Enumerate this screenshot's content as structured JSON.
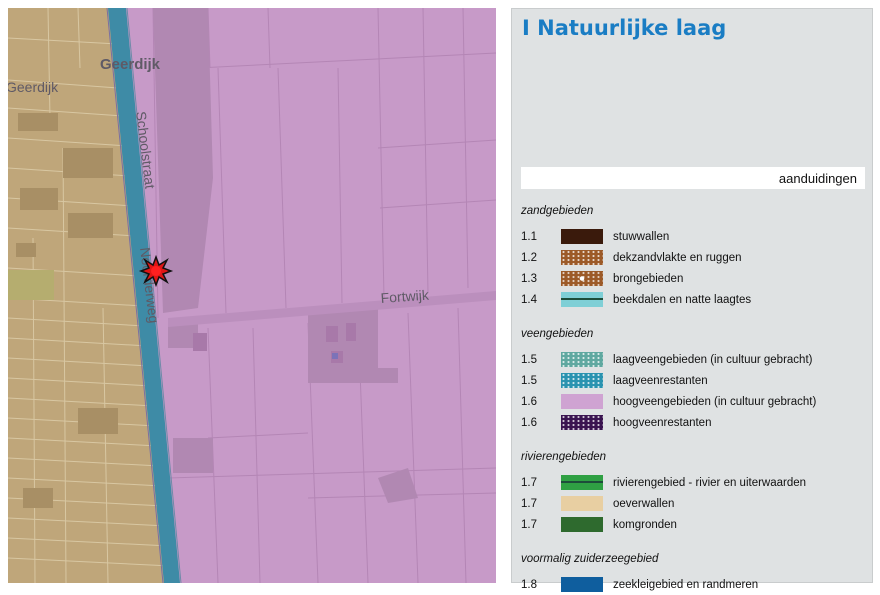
{
  "map": {
    "street_labels": {
      "geerdijk_top": "Geerdijk",
      "geerdijk_left": "Geerdijk",
      "schoolstraat": "Schoolstraat",
      "noorderweg": "Noorderweg",
      "fortwijk": "Fortwijk"
    },
    "colors": {
      "sand": "#bfa67a",
      "peat": "#c79ac8",
      "water": "#3e8ba6",
      "marker": "#e01515"
    },
    "marker_icon": "location-star-icon"
  },
  "legend": {
    "title": "I Natuurlijke laag",
    "aanduidingen_label": "aanduidingen",
    "sections": [
      {
        "heading": "zandgebieden",
        "items": [
          {
            "code": "1.1",
            "label": "stuwwallen",
            "color": "#3a1a0c",
            "pattern": "solid"
          },
          {
            "code": "1.2",
            "label": "dekzandvlakte en ruggen",
            "color": "#9c5a28",
            "pattern": "dots"
          },
          {
            "code": "1.3",
            "label": "brongebieden",
            "color": "#9c5a28",
            "pattern": "dots-center"
          },
          {
            "code": "1.4",
            "label": "beekdalen en natte laagtes",
            "color": "#7fcfd6",
            "pattern": "line"
          }
        ]
      },
      {
        "heading": "veengebieden",
        "items": [
          {
            "code": "1.5",
            "label": "laagveengebieden (in cultuur gebracht)",
            "color": "#5fa8a0",
            "pattern": "dots"
          },
          {
            "code": "1.5",
            "label": "laagveenrestanten",
            "color": "#2a93b0",
            "pattern": "dots"
          },
          {
            "code": "1.6",
            "label": "hoogveengebieden (in cultuur gebracht)",
            "color": "#cfa3d2",
            "pattern": "solid"
          },
          {
            "code": "1.6",
            "label": "hoogveenrestanten",
            "color": "#3a1450",
            "pattern": "dots"
          }
        ]
      },
      {
        "heading": "rivierengebieden",
        "items": [
          {
            "code": "1.7",
            "label": "rivierengebied - rivier en uiterwaarden",
            "color": "#2fa043",
            "pattern": "line"
          },
          {
            "code": "1.7",
            "label": "oeverwallen",
            "color": "#e8cfa2",
            "pattern": "solid"
          },
          {
            "code": "1.7",
            "label": "komgronden",
            "color": "#2e6a2e",
            "pattern": "solid"
          }
        ]
      },
      {
        "heading": "voormalig zuiderzeegebied",
        "items": [
          {
            "code": "1.8",
            "label": "zeekleigebied en randmeren",
            "color": "#0f5e9e",
            "pattern": "solid"
          }
        ]
      }
    ]
  }
}
